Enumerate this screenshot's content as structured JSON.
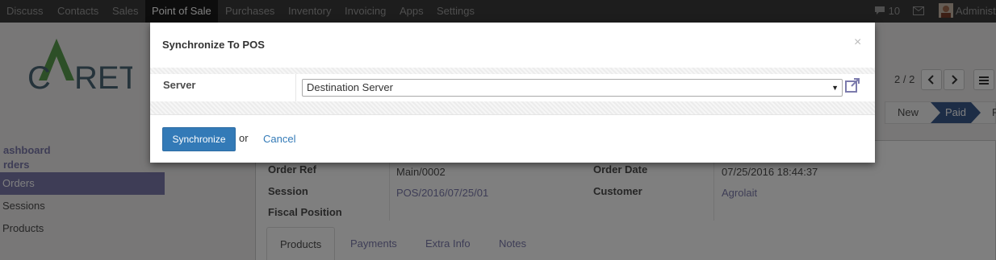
{
  "navbar": {
    "menu": [
      "Discuss",
      "Contacts",
      "Sales",
      "Point of Sale",
      "Purchases",
      "Inventory",
      "Invoicing",
      "Apps",
      "Settings"
    ],
    "active_menu": "Point of Sale",
    "message_count": "10",
    "user_name": "Administ"
  },
  "logo": {
    "text_left": "C",
    "text_right": "RET"
  },
  "sidebar": {
    "dashboard": "ashboard",
    "orders_head": "rders",
    "items": [
      "Orders",
      "Sessions",
      "Products"
    ],
    "active_item": "Orders"
  },
  "pager": {
    "value": "2 / 2",
    "prev_icon": "chevron-left",
    "next_icon": "chevron-right",
    "list_icon": "list"
  },
  "statusbar": {
    "states": [
      "New",
      "Paid",
      "F"
    ],
    "current": "Paid"
  },
  "form": {
    "order_ref_label": "Order Ref",
    "order_ref_value": "Main/0002",
    "session_label": "Session",
    "session_value": "POS/2016/07/25/01",
    "fiscal_position_label": "Fiscal Position",
    "order_date_label": "Order Date",
    "order_date_value": "07/25/2016 18:44:37",
    "customer_label": "Customer",
    "customer_value": "Agrolait",
    "tabs": [
      "Products",
      "Payments",
      "Extra Info",
      "Notes"
    ]
  },
  "modal": {
    "title": "Synchronize To POS",
    "close": "×",
    "server_label": "Server",
    "server_value": "Destination Server",
    "primary_button": "Synchronize",
    "or_text": "or",
    "cancel_link": "Cancel"
  },
  "colors": {
    "navbar": "#3a3a3a",
    "accent": "#7c7bad",
    "primary": "#337ab7",
    "status_active": "#3b5a8c"
  }
}
